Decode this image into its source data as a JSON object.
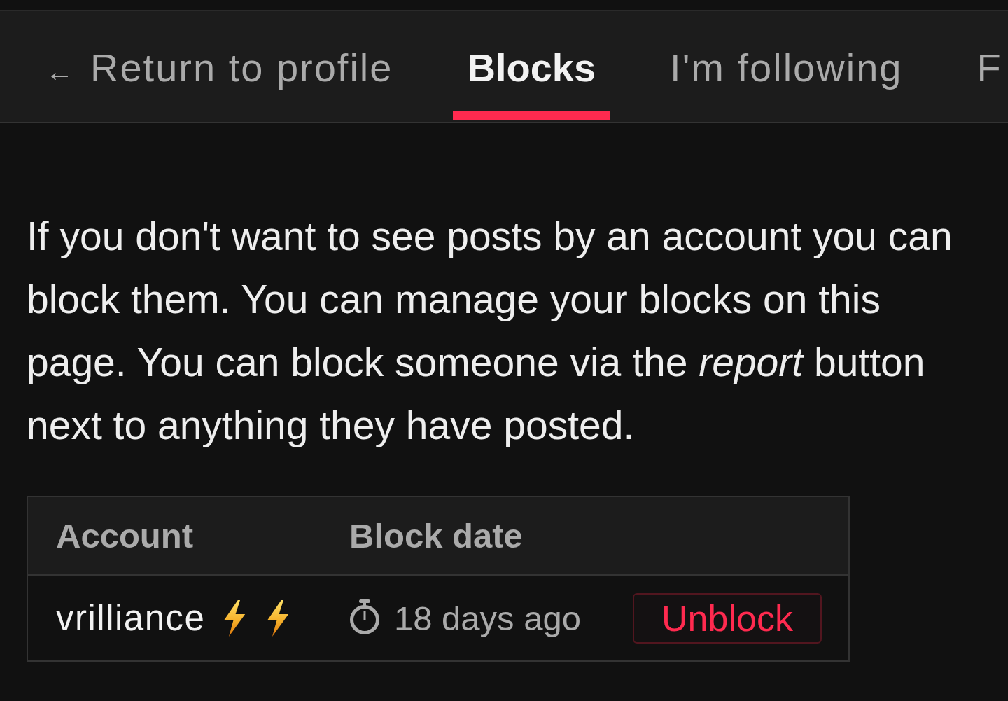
{
  "tabs": [
    {
      "prefix": "←",
      "label": "Return to profile",
      "selected": false
    },
    {
      "label": "Blocks",
      "selected": true
    },
    {
      "label": "I'm following",
      "selected": false
    },
    {
      "label": "F",
      "selected": false
    }
  ],
  "intro": "If you don't want to see posts by an account you can block them. You can manage your blocks on this page. You can block someone via the *report* button next to anything they have posted.",
  "table": {
    "columns": [
      "Account",
      "Block date"
    ],
    "rows": [
      {
        "account": "vrilliance",
        "badges": [
          {
            "kind": "lightning"
          },
          {
            "kind": "lightning"
          }
        ],
        "block_date": "18 days ago",
        "action": "Unblock"
      }
    ]
  }
}
